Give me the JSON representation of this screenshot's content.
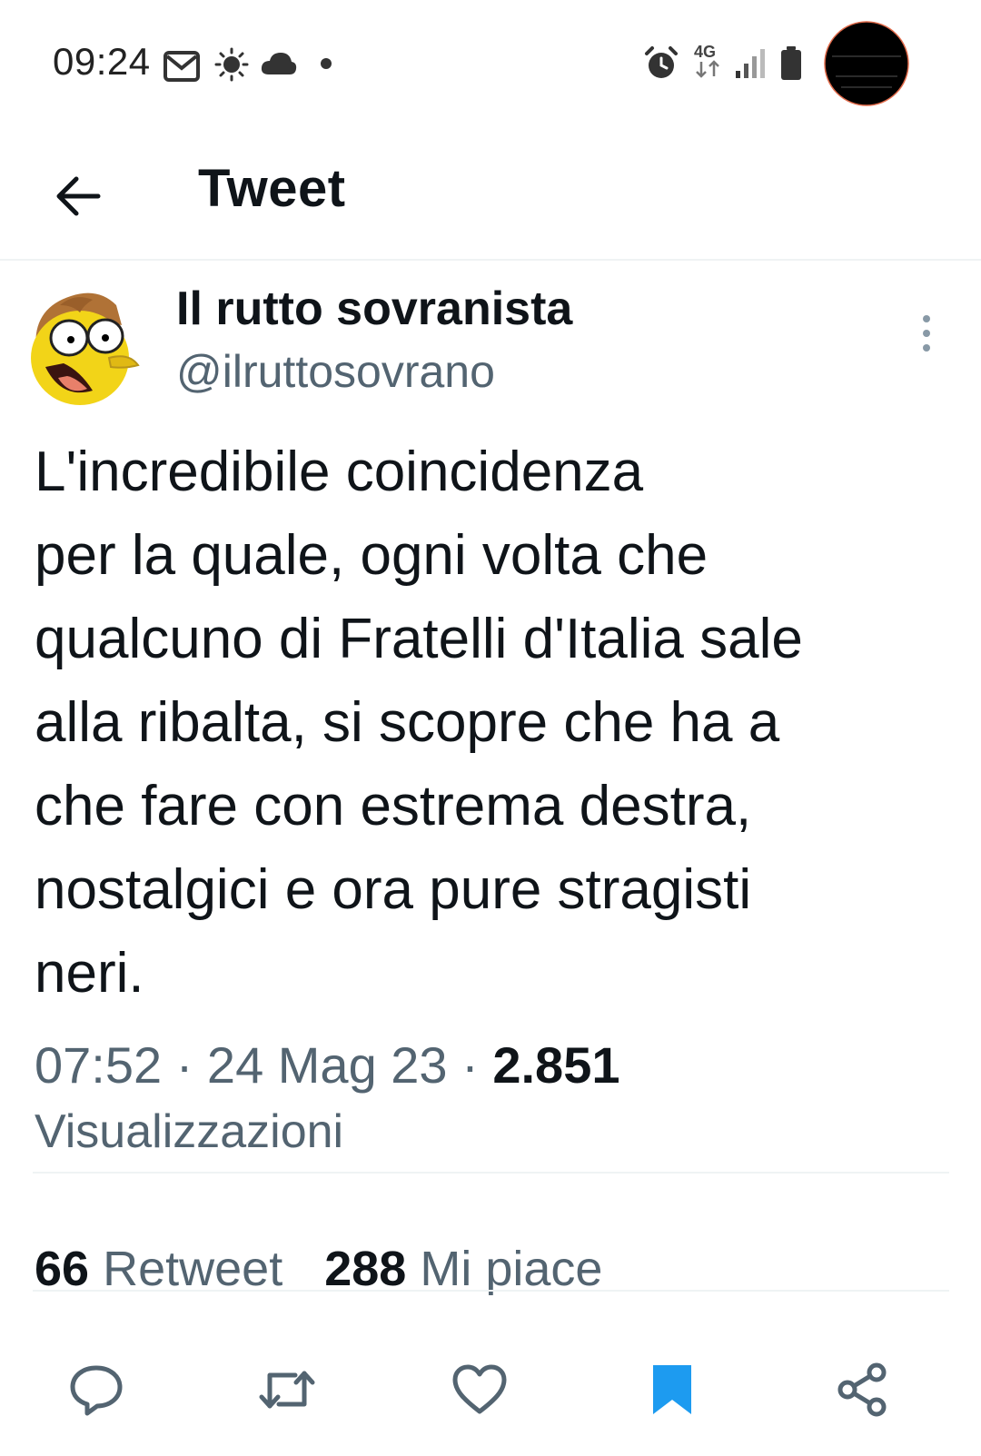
{
  "status_bar": {
    "time": "09:24",
    "network": "4G",
    "icons_left": [
      "mail-icon",
      "brightness-icon",
      "cloud-icon",
      "dot-icon"
    ],
    "icons_right": [
      "alarm-icon",
      "network-4g-icon",
      "signal-icon",
      "battery-icon",
      "camera-icon"
    ]
  },
  "header": {
    "title": "Tweet",
    "back_icon": "arrow-left-icon"
  },
  "tweet": {
    "author_name": "Il rutto sovranista",
    "author_handle": "@ilruttosovrano",
    "text_lines": [
      "L'incredibile coincidenza",
      "per la quale, ogni volta che",
      "qualcuno di Fratelli d'Italia sale",
      "alla ribalta, si scopre che ha a",
      "che fare con estrema destra,",
      "nostalgici e ora pure stragisti",
      "neri."
    ],
    "time": "07:52",
    "separator": "·",
    "date": "24 Mag 23",
    "views_count": "2.851",
    "views_label": "Visualizzazioni"
  },
  "stats": {
    "retweets_count": "66",
    "retweets_label": "Retweet",
    "likes_count": "288",
    "likes_label": "Mi piace"
  },
  "actions": [
    "reply-icon",
    "retweet-icon",
    "like-icon",
    "bookmark-icon",
    "share-icon"
  ],
  "colors": {
    "text_primary": "#0f1419",
    "text_secondary": "#536471",
    "accent": "#1d9bf0",
    "divider": "#eff3f4"
  }
}
